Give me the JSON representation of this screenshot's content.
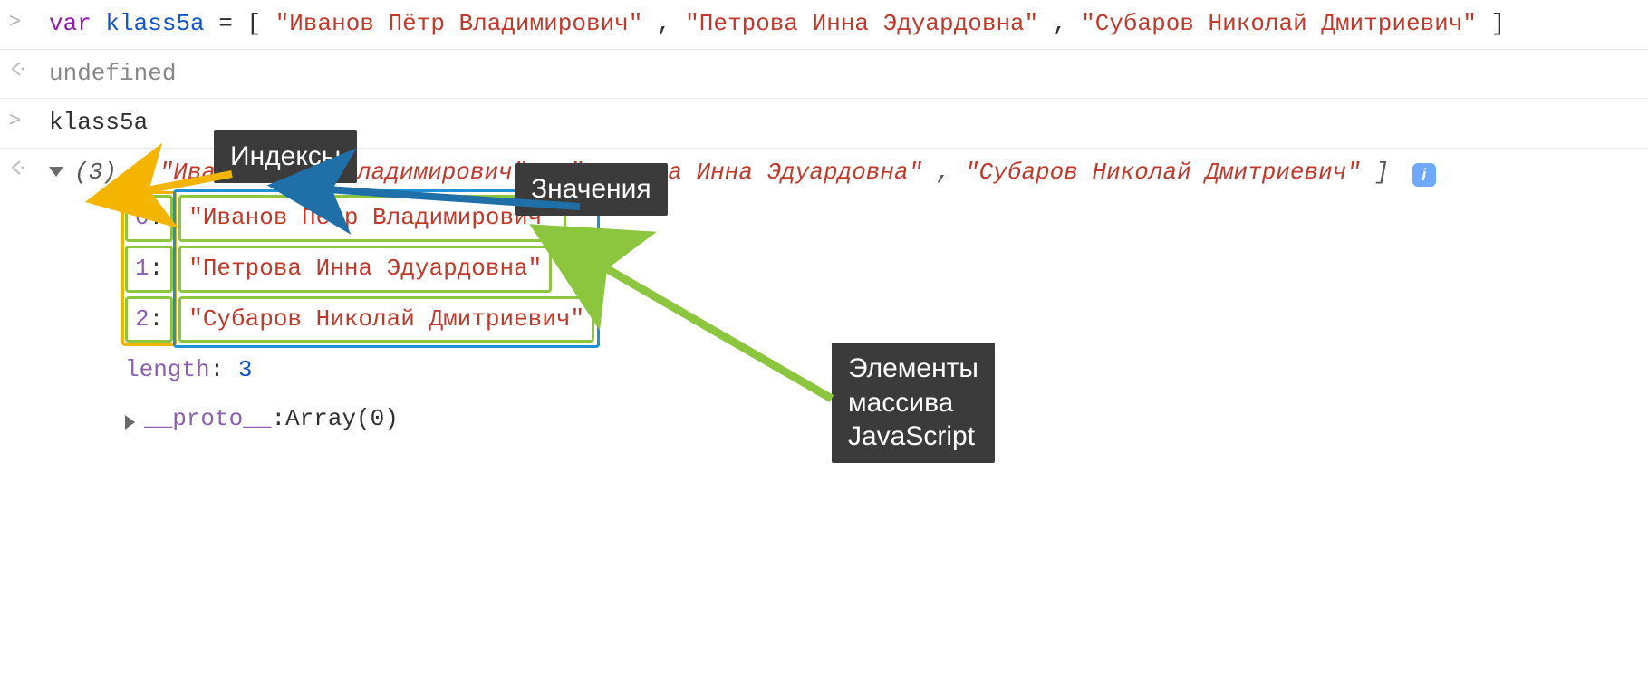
{
  "console": {
    "input_prompt": ">",
    "output_prompt": "<·",
    "line1": {
      "var_kw": "var",
      "ident": "klass5a",
      "eq": " = ",
      "open": "[",
      "close": "]",
      "sep": ", ",
      "values": [
        "\"Иванов Пётр Владимирович\"",
        "\"Петрова Инна Эдуардовна\"",
        "\"Субаров Николай Дмитриевич\""
      ]
    },
    "undefined_label": "undefined",
    "eval_expr": "klass5a",
    "preview": {
      "count": "(3)",
      "open": "[",
      "close": "]",
      "sep": ", ",
      "values": [
        "\"Иванов Пётр Владимирович\"",
        "\"Петрова Инна Эдуардовна\"",
        "\"Субаров Николай Дмитриевич\""
      ],
      "info_glyph": "i"
    },
    "elements": [
      {
        "index": "0",
        "value": "\"Иванов Пётр Владимирович\""
      },
      {
        "index": "1",
        "value": "\"Петрова Инна Эдуардовна\""
      },
      {
        "index": "2",
        "value": "\"Субаров Николай Дмитриевич\""
      }
    ],
    "length_label": "length",
    "length_value": "3",
    "proto_label": "__proto__",
    "proto_value": "Array(0)"
  },
  "callouts": {
    "indexes": "Индексы",
    "values": "Значения",
    "elements": "Элементы\nмассива\nJavaScript"
  },
  "colors": {
    "yellow": "#f5b400",
    "blue": "#1f6fa8",
    "green": "#8cc63f"
  }
}
